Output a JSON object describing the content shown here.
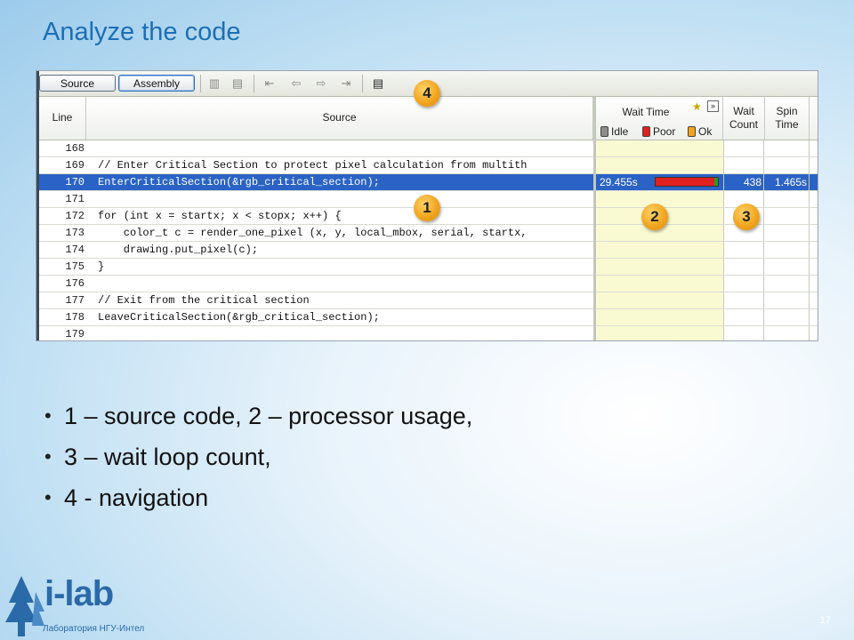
{
  "slide": {
    "title": "Analyze the code",
    "page_number": "17"
  },
  "toolbar": {
    "source_button": "Source",
    "assembly_button": "Assembly"
  },
  "table": {
    "headers": {
      "line": "Line",
      "source": "Source",
      "wait_time": "Wait Time",
      "wait_count_1": "Wait",
      "wait_count_2": "Count",
      "spin_time_1": "Spin",
      "spin_time_2": "Time"
    },
    "legend": [
      {
        "label": "Idle",
        "color": "#8c8c8c"
      },
      {
        "label": "Poor",
        "color": "#e12020"
      },
      {
        "label": "Ok",
        "color": "#f0a21a"
      }
    ],
    "rows": [
      {
        "line": "168",
        "code": ""
      },
      {
        "line": "169",
        "code": "// Enter Critical Section to protect pixel calculation from multith"
      },
      {
        "line": "170",
        "code": "EnterCriticalSection(&rgb_critical_section);",
        "wait_time": "29.455s",
        "wait_count": "438",
        "spin_time": "1.465s",
        "poor_fraction": 0.95
      },
      {
        "line": "171",
        "code": ""
      },
      {
        "line": "172",
        "code": "for (int x = startx; x < stopx; x++) {"
      },
      {
        "line": "173",
        "code": "    color_t c = render_one_pixel (x, y, local_mbox, serial, startx,"
      },
      {
        "line": "174",
        "code": "    drawing.put_pixel(c);"
      },
      {
        "line": "175",
        "code": "}"
      },
      {
        "line": "176",
        "code": ""
      },
      {
        "line": "177",
        "code": "// Exit from the critical section"
      },
      {
        "line": "178",
        "code": "LeaveCriticalSection(&rgb_critical_section);"
      },
      {
        "line": "179",
        "code": ""
      }
    ]
  },
  "callouts": [
    "1",
    "2",
    "3",
    "4"
  ],
  "bullets": [
    "1 – source code, 2 – processor usage,",
    "3 – wait loop count,",
    "4 - navigation"
  ],
  "logo": {
    "text": "i-lab",
    "subtitle": "Лаборатория НГУ-Интел"
  },
  "colors": {
    "title": "#1c6fb5",
    "selection": "#2a63c5",
    "wait_column": "#fafad2",
    "callout": "#f0a21a"
  }
}
